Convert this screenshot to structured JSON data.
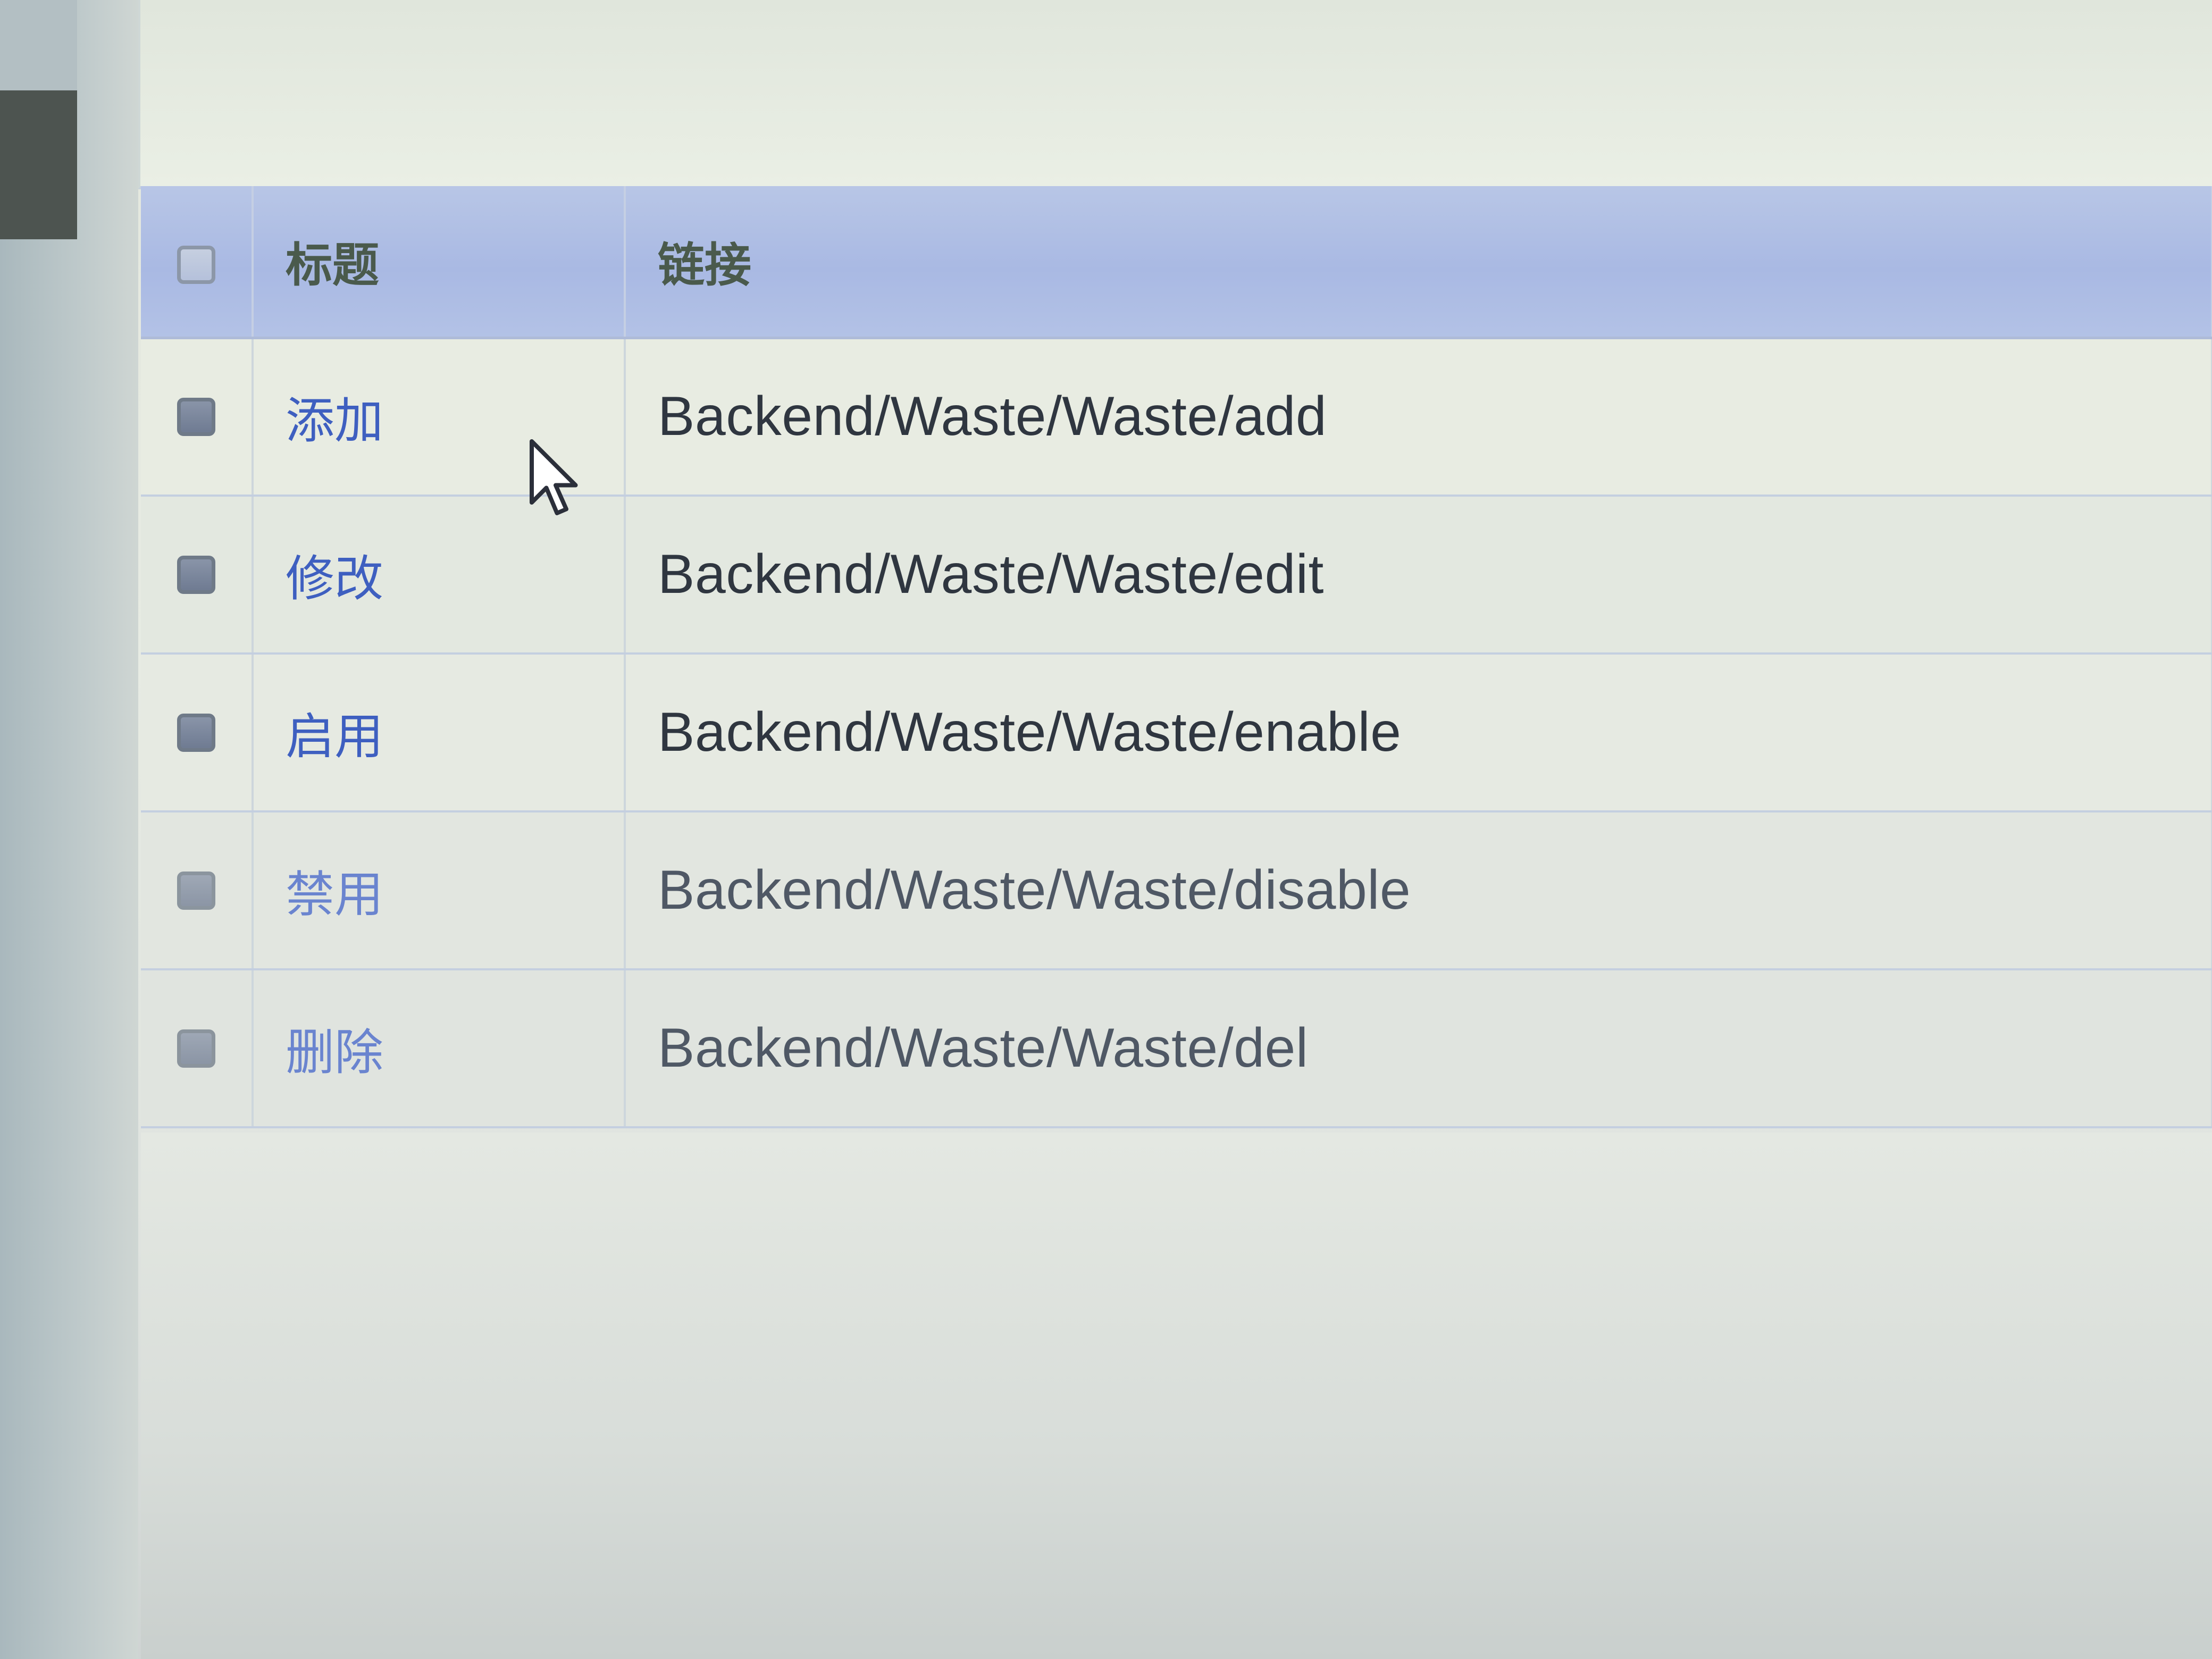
{
  "grid": {
    "header": {
      "select_all_checked": false,
      "title_label": "标题",
      "link_label": "链接"
    },
    "rows": [
      {
        "checked": false,
        "title": "添加",
        "link": "Backend/Waste/Waste/add"
      },
      {
        "checked": false,
        "title": "修改",
        "link": "Backend/Waste/Waste/edit"
      },
      {
        "checked": false,
        "title": "启用",
        "link": "Backend/Waste/Waste/enable"
      },
      {
        "checked": false,
        "title": "禁用",
        "link": "Backend/Waste/Waste/disable"
      },
      {
        "checked": false,
        "title": "删除",
        "link": "Backend/Waste/Waste/del"
      }
    ]
  },
  "colors": {
    "header_bg": "#a9b9e3",
    "title_link": "#3e5fc0",
    "route_text": "#2f3640"
  },
  "icons": {
    "cursor": "mouse-pointer-arrow-icon",
    "checkbox": "checkbox-icon"
  }
}
